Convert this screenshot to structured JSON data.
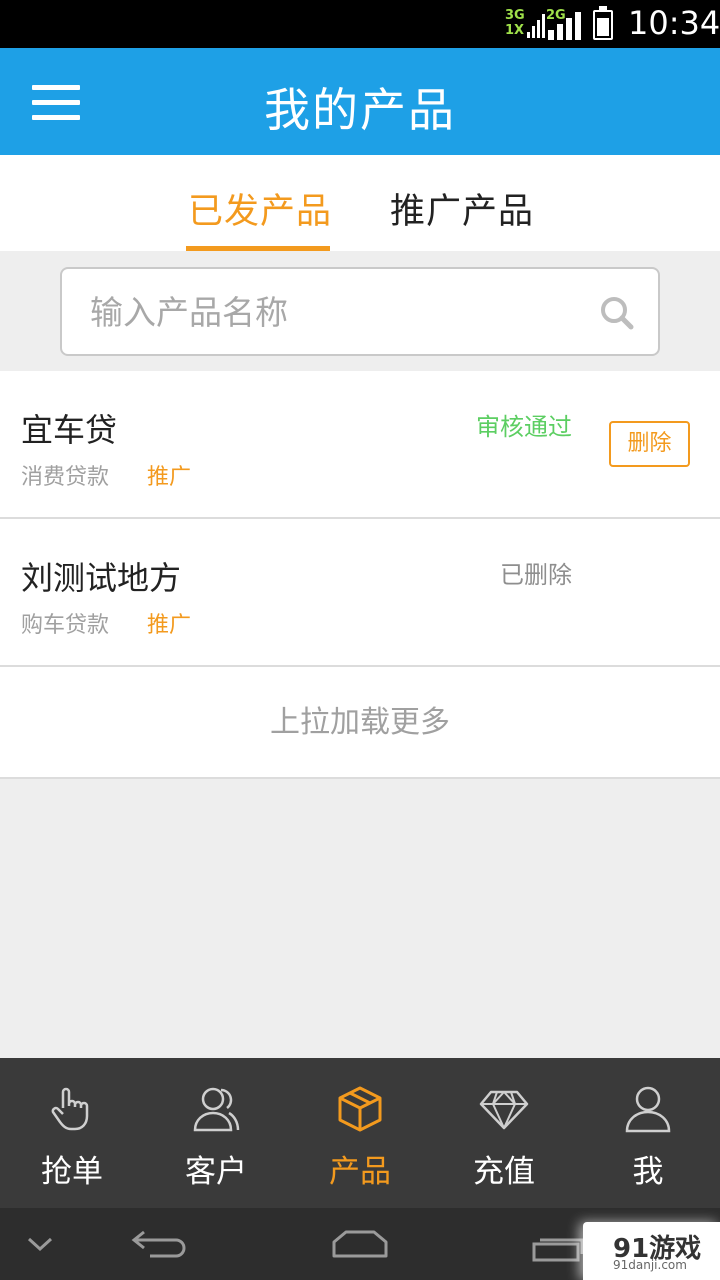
{
  "status_bar": {
    "network_top": "3G",
    "network_bottom": "1X",
    "network_2g": "2G",
    "time": "10:34"
  },
  "header": {
    "title": "我的产品",
    "menu_icon": "hamburger-menu-icon"
  },
  "tabs": [
    {
      "label": "已发产品",
      "active": true
    },
    {
      "label": "推广产品",
      "active": false
    }
  ],
  "search": {
    "placeholder": "输入产品名称",
    "value": "",
    "icon": "search-icon"
  },
  "products": [
    {
      "name": "宜车贷",
      "category": "消费贷款",
      "promote": "推广",
      "status": "审核通过",
      "status_color": "#5cce62",
      "action": "删除"
    },
    {
      "name": "刘测试地方",
      "category": "购车贷款",
      "promote": "推广",
      "status": "已删除",
      "status_color": "#8e8e8e"
    }
  ],
  "load_more": "上拉加载更多",
  "bottom_nav": [
    {
      "label": "抢单",
      "icon": "hand-pointer-icon",
      "active": false
    },
    {
      "label": "客户",
      "icon": "users-icon",
      "active": false
    },
    {
      "label": "产品",
      "icon": "box-icon",
      "active": true
    },
    {
      "label": "充值",
      "icon": "diamond-icon",
      "active": false
    },
    {
      "label": "我",
      "icon": "user-icon",
      "active": false
    }
  ],
  "colors": {
    "header_bg": "#1ea0e6",
    "accent": "#f39a1e",
    "approved": "#5cce62",
    "nav_bg": "#3a3a3a"
  },
  "watermark": {
    "main": "91游戏",
    "sub": "91danji.com"
  }
}
